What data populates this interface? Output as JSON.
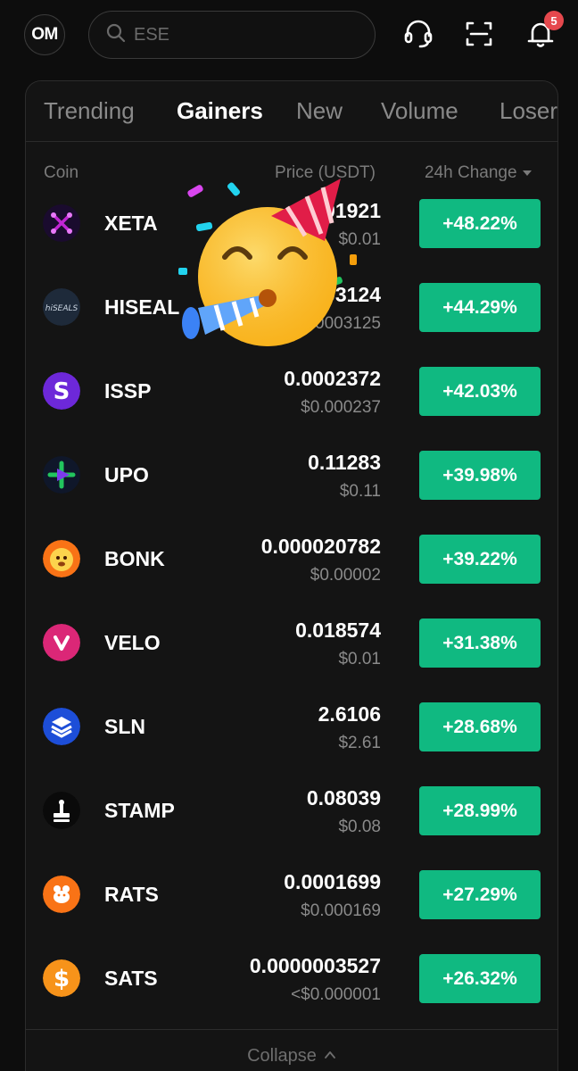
{
  "header": {
    "avatar_initials": "OM",
    "search_placeholder": "ESE",
    "notification_count": "5"
  },
  "tabs": [
    {
      "label": "Trending",
      "active": false
    },
    {
      "label": "Gainers",
      "active": true
    },
    {
      "label": "New",
      "active": false
    },
    {
      "label": "Volume",
      "active": false
    },
    {
      "label": "Losers",
      "active": false
    }
  ],
  "columns": {
    "coin": "Coin",
    "price": "Price (USDT)",
    "change": "24h Change"
  },
  "rows": [
    {
      "symbol": "XETA",
      "price": "0.01921",
      "usd": "$0.01",
      "change": "+48.22%",
      "logo": "xeta-logo"
    },
    {
      "symbol": "HISEAL",
      "price": "0.0003124",
      "usd": "$0.0003125",
      "change": "+44.29%",
      "logo": "hiseals-logo"
    },
    {
      "symbol": "ISSP",
      "price": "0.0002372",
      "usd": "$0.000237",
      "change": "+42.03%",
      "logo": "issp-logo"
    },
    {
      "symbol": "UPO",
      "price": "0.11283",
      "usd": "$0.11",
      "change": "+39.98%",
      "logo": "upo-logo"
    },
    {
      "symbol": "BONK",
      "price": "0.000020782",
      "usd": "$0.00002",
      "change": "+39.22%",
      "logo": "bonk-logo"
    },
    {
      "symbol": "VELO",
      "price": "0.018574",
      "usd": "$0.01",
      "change": "+31.38%",
      "logo": "velo-logo"
    },
    {
      "symbol": "SLN",
      "price": "2.6106",
      "usd": "$2.61",
      "change": "+28.68%",
      "logo": "sln-logo"
    },
    {
      "symbol": "STAMP",
      "price": "0.08039",
      "usd": "$0.08",
      "change": "+28.99%",
      "logo": "stamp-logo"
    },
    {
      "symbol": "RATS",
      "price": "0.0001699",
      "usd": "$0.000169",
      "change": "+27.29%",
      "logo": "rats-logo"
    },
    {
      "symbol": "SATS",
      "price": "0.0000003527",
      "usd": "<$0.000001",
      "change": "+26.32%",
      "logo": "sats-logo"
    }
  ],
  "footer": {
    "collapse_label": "Collapse"
  },
  "colors": {
    "accent_green": "#10b981",
    "badge_red": "#e5484d",
    "background": "#0d0d0d"
  },
  "overlay": {
    "emoji": "partying-face-emoji"
  }
}
